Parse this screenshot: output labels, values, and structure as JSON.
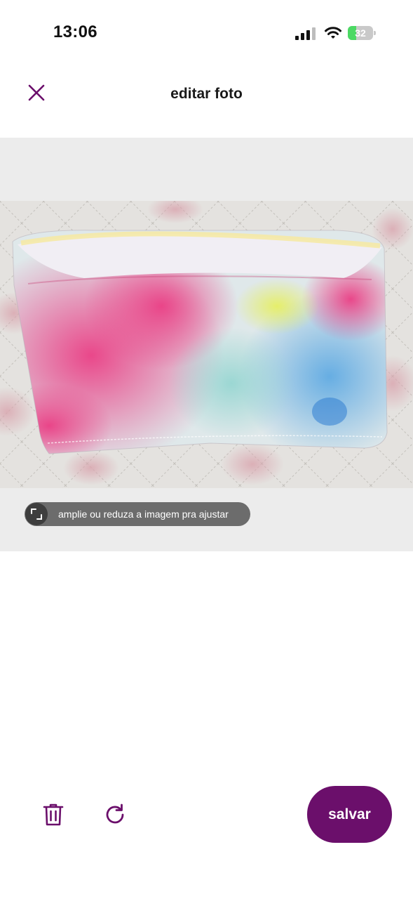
{
  "status_bar": {
    "time": "13:06",
    "battery_percent": "32",
    "battery_level": 0.32,
    "icons": [
      "cellular-signal-icon",
      "wifi-icon",
      "battery-charging-icon"
    ]
  },
  "header": {
    "title": "editar foto",
    "close_icon": "close-icon"
  },
  "editor": {
    "hint": "amplie ou reduza a imagem pra ajustar",
    "hint_icon": "resize-icon"
  },
  "toolbar": {
    "delete_icon": "trash-icon",
    "rotate_icon": "rotate-icon",
    "save_label": "salvar"
  },
  "colors": {
    "accent": "#6b0f6b",
    "editor_background": "#ececec",
    "hint_background": "#6c6c6c"
  }
}
